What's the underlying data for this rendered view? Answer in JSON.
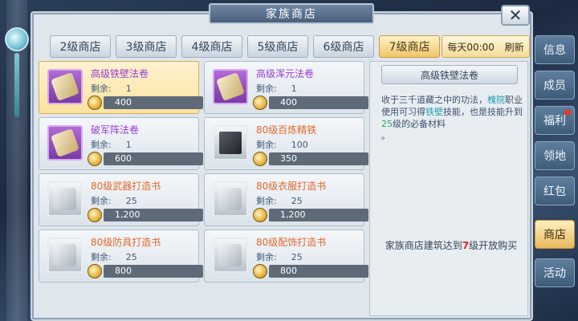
{
  "window": {
    "title": "家族商店"
  },
  "tabs": [
    {
      "label": "2级商店"
    },
    {
      "label": "3级商店"
    },
    {
      "label": "4级商店"
    },
    {
      "label": "5级商店"
    },
    {
      "label": "6级商店"
    },
    {
      "label": "7级商店",
      "active": true
    }
  ],
  "refresh": {
    "time_label": "每天00:00",
    "refresh_label": "刷新"
  },
  "items": [
    {
      "name": "高级铁壁法卷",
      "remain_label": "剩余:",
      "remain": "1",
      "price": "400",
      "rarity": "purple",
      "icon": "scroll-icon"
    },
    {
      "name": "高级浑元法卷",
      "remain_label": "剩余:",
      "remain": "1",
      "price": "400",
      "rarity": "purple",
      "icon": "scroll-icon"
    },
    {
      "name": "破军阵法卷",
      "remain_label": "剩余:",
      "remain": "1",
      "price": "600",
      "rarity": "purple",
      "icon": "scroll-icon"
    },
    {
      "name": "80级百炼精铁",
      "remain_label": "剩余:",
      "remain": "100",
      "price": "350",
      "rarity": "orange",
      "icon": "iron-icon"
    },
    {
      "name": "80级武器打造书",
      "remain_label": "剩余:",
      "remain": "25",
      "price": "1,200",
      "rarity": "orange",
      "icon": "book-icon"
    },
    {
      "name": "80级衣服打造书",
      "remain_label": "剩余:",
      "remain": "25",
      "price": "1,200",
      "rarity": "orange",
      "icon": "book-icon"
    },
    {
      "name": "80级防具打造书",
      "remain_label": "剩余:",
      "remain": "25",
      "price": "800",
      "rarity": "orange",
      "icon": "book-icon"
    },
    {
      "name": "80级配饰打造书",
      "remain_label": "剩余:",
      "remain": "25",
      "price": "800",
      "rarity": "orange",
      "icon": "book-icon"
    }
  ],
  "detail": {
    "title": "高级铁壁法卷",
    "desc_1": "收于三千道藏之中的功法，",
    "desc_sect": "槐院",
    "desc_2": "职业使用可习得",
    "desc_skill": "铁壁",
    "desc_3": "技能，也是技能升到",
    "desc_level": "25",
    "desc_4": "级的必备材料",
    "desc_5": "。",
    "footer_1": "家族商店建筑达到",
    "footer_level": "7",
    "footer_2": "级开放购买"
  },
  "menu": [
    {
      "label": "信息"
    },
    {
      "label": "成员"
    },
    {
      "label": "福利",
      "badge": true
    },
    {
      "label": "领地"
    },
    {
      "label": "红包"
    },
    {
      "label": "商店",
      "active": true
    },
    {
      "label": "活动"
    }
  ],
  "colors": {
    "purple_name": "#9a3bd0",
    "orange_name": "#e0682a",
    "highlight_red": "#e32020",
    "highlight_cyan": "#1e9fb4"
  }
}
